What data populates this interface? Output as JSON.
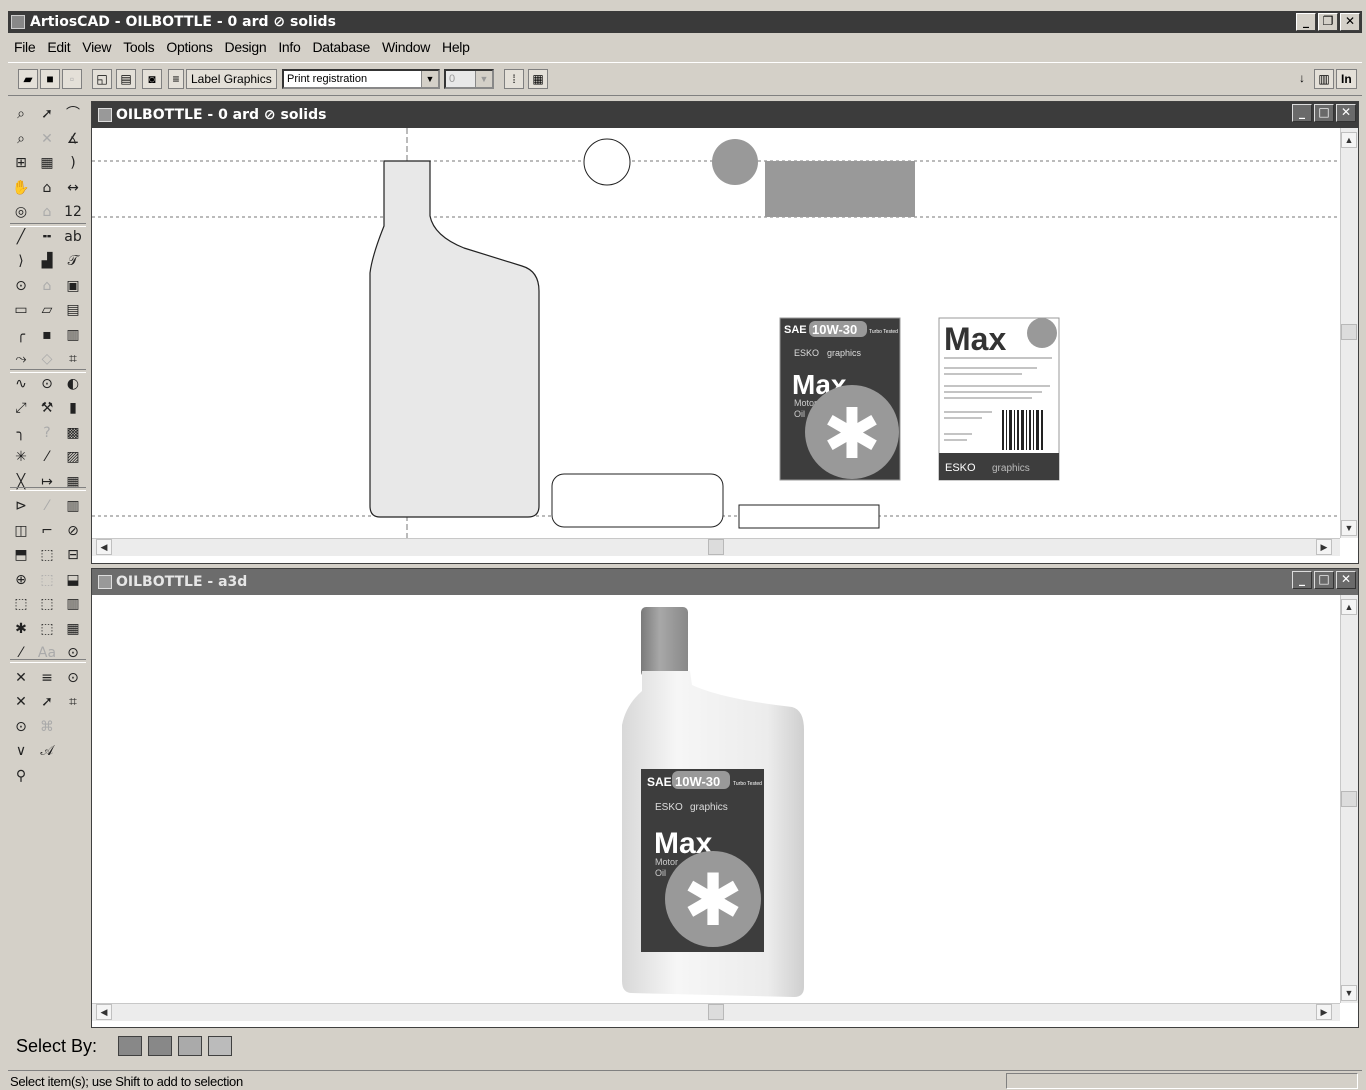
{
  "app": {
    "title": "ArtiosCAD - OILBOTTLE - 0 ard ⊘ solids"
  },
  "window_controls": {
    "minimize": "_",
    "restore": "❐",
    "close": "✕",
    "maximize": "□"
  },
  "menu": [
    "File",
    "Edit",
    "View",
    "Tools",
    "Options",
    "Design",
    "Info",
    "Database",
    "Window",
    "Help"
  ],
  "toolbar": {
    "label_graphics": "Label Graphics",
    "print_registration": "Print registration",
    "number_value": "0",
    "right_in": "In"
  },
  "icons": {
    "app": "artioscad-icon",
    "palette": [
      "zoom-in-icon",
      "select-arrow-icon",
      "line-tool-icon",
      "zoom-out-icon",
      "cross-icon",
      "angle-icon",
      "zoom-box-icon",
      "grid-icon",
      "arc-icon",
      "pan-hand-icon",
      "fit-icon",
      "dimension-icon",
      "view-3d-icon",
      "measure-icon",
      "number-12-icon"
    ]
  },
  "windows": {
    "design": {
      "title": "OILBOTTLE - 0 ard ⊘ solids",
      "label_front": {
        "sae": "SAE",
        "grade": "10W-30",
        "turbo": "Turbo Tested",
        "esko": "ESKO",
        "graphics": "graphics",
        "brand": "Max",
        "motor": "Motor",
        "oil": "Oil",
        "asterisk": "✱"
      },
      "label_back": {
        "brand": "Max",
        "esko": "ESKO",
        "graphics": "graphics"
      }
    },
    "viewer3d": {
      "title": "OILBOTTLE - a3d",
      "label_front": {
        "sae": "SAE",
        "grade": "10W-30",
        "turbo": "Turbo Tested",
        "esko": "ESKO",
        "graphics": "graphics",
        "brand": "Max",
        "motor": "Motor",
        "oil": "Oil",
        "asterisk": "✱"
      }
    }
  },
  "status": {
    "select_by_label": "Select By:",
    "message": "Select item(s); use Shift to add to selection"
  },
  "colors": {
    "titlebar": "#3a3a3a",
    "label_dark": "#3d3d3d",
    "label_gray": "#999999",
    "bottle_fill": "#e8e8e8"
  }
}
